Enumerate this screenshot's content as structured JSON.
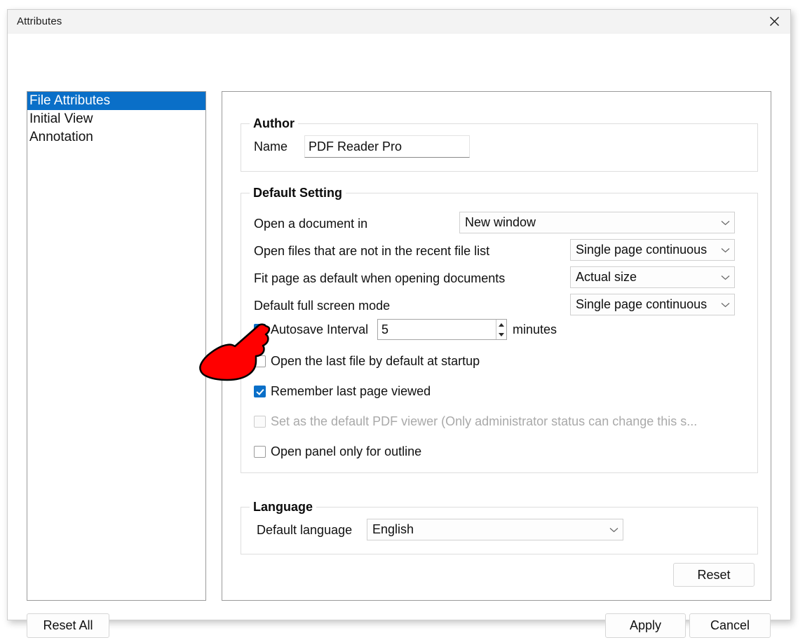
{
  "window": {
    "title": "Attributes",
    "close_icon": "close-icon"
  },
  "sidebar": {
    "items": [
      {
        "label": "File Attributes",
        "selected": true
      },
      {
        "label": "Initial View",
        "selected": false
      },
      {
        "label": "Annotation",
        "selected": false
      }
    ]
  },
  "author": {
    "group_title": "Author",
    "name_label": "Name",
    "name_value": "PDF Reader Pro",
    "name_placeholder": "Name"
  },
  "default_setting": {
    "group_title": "Default Setting",
    "rows": [
      {
        "label": "Open a document in",
        "value": "New window"
      },
      {
        "label": "Open files that are not in the recent file list",
        "value": "Single page continuous"
      },
      {
        "label": "Fit page as default when opening documents",
        "value": "Actual size"
      },
      {
        "label": "Default full screen mode",
        "value": "Single page continuous"
      }
    ],
    "autosave": {
      "label": "Autosave Interval",
      "checked": true,
      "value": "5",
      "unit": "minutes"
    },
    "checkboxes": [
      {
        "label": "Open the last file by default at startup",
        "checked": false,
        "disabled": false
      },
      {
        "label": "Remember last page viewed",
        "checked": true,
        "disabled": false
      },
      {
        "label": "Set as the default PDF viewer (Only administrator status can change this s...",
        "checked": false,
        "disabled": true
      },
      {
        "label": "Open panel only for outline",
        "checked": false,
        "disabled": false
      }
    ]
  },
  "language": {
    "group_title": "Language",
    "label": "Default language",
    "value": "English"
  },
  "buttons": {
    "reset": "Reset",
    "reset_all": "Reset All",
    "apply": "Apply",
    "cancel": "Cancel"
  },
  "annotation": {
    "pointer": "hand-pointer-cursor",
    "color": "#FF0000"
  },
  "colors": {
    "accent": "#0a6fc8",
    "titlebar": "#f3f3f3",
    "pointer": "#FF0000"
  }
}
